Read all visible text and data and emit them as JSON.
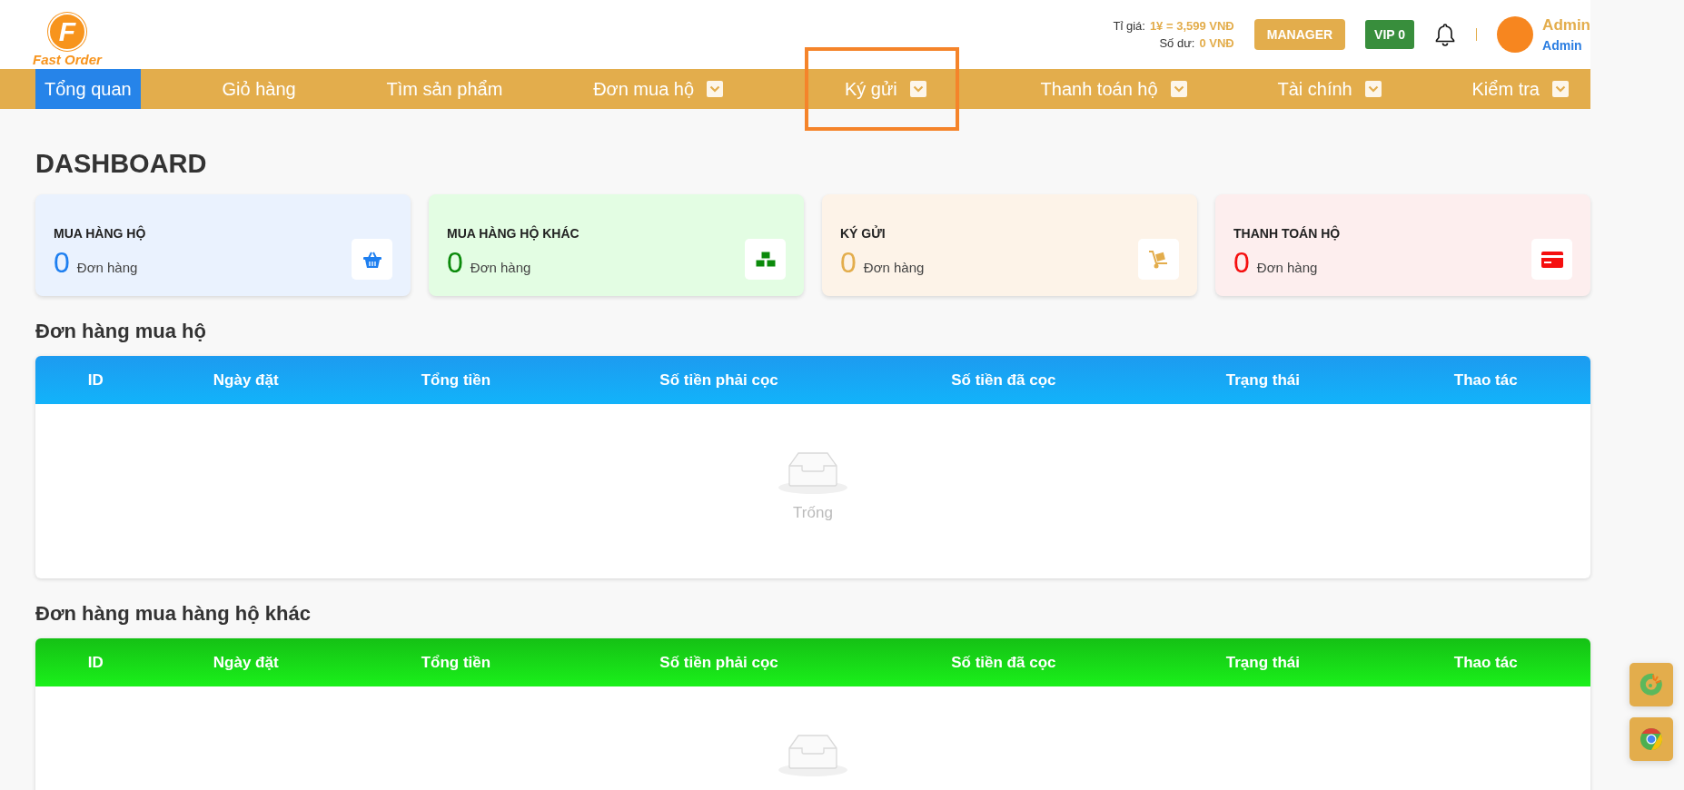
{
  "logo": {
    "letter": "F",
    "brand": "Fast Order"
  },
  "header": {
    "rate_label": "Tỉ giá:",
    "rate_value": "1¥ = 3,599 VNĐ",
    "balance_label": "Số dư:",
    "balance_value": "0 VNĐ",
    "manager_button": "MANAGER",
    "vip_badge": "VIP 0",
    "user_name": "Admin",
    "user_role": "Admin"
  },
  "nav": [
    {
      "label": "Tổng quan",
      "selected": true,
      "dropdown": false,
      "highlighted": false
    },
    {
      "label": "Giỏ hàng",
      "selected": false,
      "dropdown": false,
      "highlighted": false
    },
    {
      "label": "Tìm sản phẩm",
      "selected": false,
      "dropdown": false,
      "highlighted": false
    },
    {
      "label": "Đơn mua hộ",
      "selected": false,
      "dropdown": true,
      "highlighted": false
    },
    {
      "label": "Ký gửi",
      "selected": false,
      "dropdown": true,
      "highlighted": true
    },
    {
      "label": "Thanh toán hộ",
      "selected": false,
      "dropdown": true,
      "highlighted": false
    },
    {
      "label": "Tài chính",
      "selected": false,
      "dropdown": true,
      "highlighted": false
    },
    {
      "label": "Kiểm tra",
      "selected": false,
      "dropdown": true,
      "highlighted": false
    }
  ],
  "page_title": "DASHBOARD",
  "stats": [
    {
      "title": "MUA HÀNG HỘ",
      "count": "0",
      "unit": "Đơn hàng",
      "color": "#1e7ff0",
      "kind": "basket"
    },
    {
      "title": "MUA HÀNG HỘ KHÁC",
      "count": "0",
      "unit": "Đơn hàng",
      "color": "#0b8a0b",
      "kind": "cubes"
    },
    {
      "title": "KÝ GỬI",
      "count": "0",
      "unit": "Đơn hàng",
      "color": "#e3ad4c",
      "kind": "dolly"
    },
    {
      "title": "THANH TOÁN HỘ",
      "count": "0",
      "unit": "Đơn hàng",
      "color": "#f50f0f",
      "kind": "card"
    }
  ],
  "tables": [
    {
      "title": "Đơn hàng mua hộ",
      "kind": "blue",
      "columns": [
        "ID",
        "Ngày đặt",
        "Tổng tiền",
        "Số tiền phải cọc",
        "Số tiền đã cọc",
        "Trạng thái",
        "Thao tác"
      ],
      "empty_text": "Trống"
    },
    {
      "title": "Đơn hàng mua hàng hộ khác",
      "kind": "green",
      "columns": [
        "ID",
        "Ngày đặt",
        "Tổng tiền",
        "Số tiền phải cọc",
        "Số tiền đã cọc",
        "Trạng thái",
        "Thao tác"
      ]
    }
  ]
}
